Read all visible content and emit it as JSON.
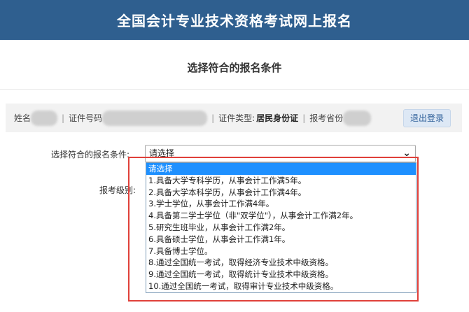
{
  "header": {
    "title": "全国会计专业技术资格考试网上报名"
  },
  "page": {
    "subtitle": "选择符合的报名条件"
  },
  "user_bar": {
    "name_label": "姓名",
    "sep": "|",
    "id_label": "证件号码",
    "id_type_label": "证件类型:",
    "id_type_value": "居民身份证",
    "province_label": "报考省份",
    "logout_label": "退出登录"
  },
  "form": {
    "condition_label": "选择符合的报名条件:",
    "level_label": "报考级别:",
    "condition_select": {
      "selected": "请选择",
      "options": [
        "请选择",
        "1.具备大学专科学历，从事会计工作满5年。",
        "2.具备大学本科学历，从事会计工作满4年。",
        "3.学士学位，从事会计工作满4年。",
        "4.具备第二学士学位（非\"双学位\"），从事会计工作满2年。",
        "5.研究生班毕业，从事会计工作满2年。",
        "6.具备硕士学位，从事会计工作满1年。",
        "7.具备博士学位。",
        "8.通过全国统一考试，取得经济专业技术中级资格。",
        "9.通过全国统一考试，取得统计专业技术中级资格。",
        "10.通过全国统一考试，取得审计专业技术中级资格。"
      ]
    }
  },
  "icons": {
    "dropdown": "chevron-down-icon"
  },
  "colors": {
    "banner": "#2f5f8f",
    "highlight": "#e0403a",
    "selected_option": "#1e90ff"
  }
}
